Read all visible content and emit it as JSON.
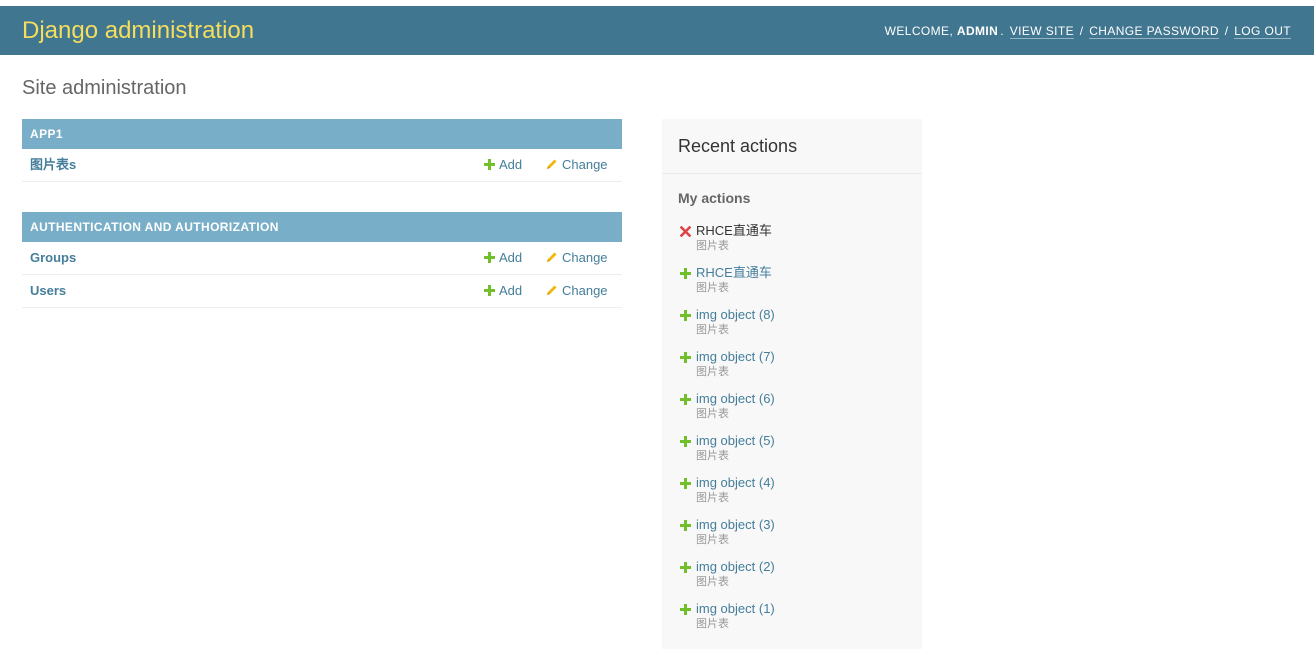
{
  "header": {
    "branding": "Django administration",
    "welcome": "Welcome,",
    "username": "admin",
    "view_site": "View site",
    "change_password": "Change password",
    "log_out": "Log out",
    "brand_color": "#f5dd5d",
    "header_color": "#417690"
  },
  "page": {
    "title": "Site administration"
  },
  "modules": [
    {
      "caption": "APP1",
      "models": [
        {
          "name": "图片表s",
          "add": "Add",
          "change": "Change"
        }
      ]
    },
    {
      "caption": "AUTHENTICATION AND AUTHORIZATION",
      "models": [
        {
          "name": "Groups",
          "add": "Add",
          "change": "Change"
        },
        {
          "name": "Users",
          "add": "Add",
          "change": "Change"
        }
      ]
    }
  ],
  "recent_actions": {
    "title": "Recent actions",
    "subtitle": "My actions",
    "items": [
      {
        "action": "delete",
        "icon": "delete-icon",
        "title": "RHCE直通车",
        "type": "图片表"
      },
      {
        "action": "add",
        "icon": "add-icon",
        "title": "RHCE直通车",
        "type": "图片表"
      },
      {
        "action": "add",
        "icon": "add-icon",
        "title": "img object (8)",
        "type": "图片表"
      },
      {
        "action": "add",
        "icon": "add-icon",
        "title": "img object (7)",
        "type": "图片表"
      },
      {
        "action": "add",
        "icon": "add-icon",
        "title": "img object (6)",
        "type": "图片表"
      },
      {
        "action": "add",
        "icon": "add-icon",
        "title": "img object (5)",
        "type": "图片表"
      },
      {
        "action": "add",
        "icon": "add-icon",
        "title": "img object (4)",
        "type": "图片表"
      },
      {
        "action": "add",
        "icon": "add-icon",
        "title": "img object (3)",
        "type": "图片表"
      },
      {
        "action": "add",
        "icon": "add-icon",
        "title": "img object (2)",
        "type": "图片表"
      },
      {
        "action": "add",
        "icon": "add-icon",
        "title": "img object (1)",
        "type": "图片表"
      }
    ]
  }
}
